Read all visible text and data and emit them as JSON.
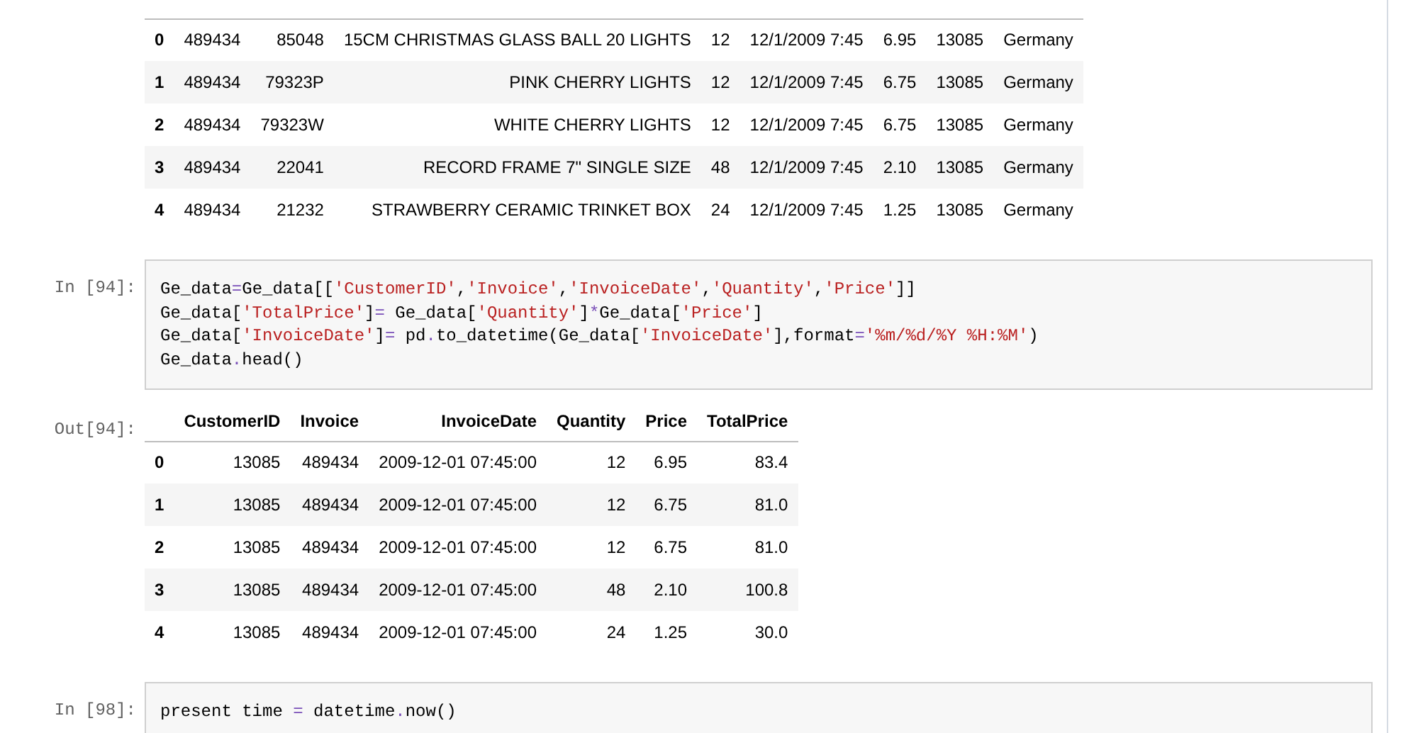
{
  "cells": [
    {
      "kind": "table",
      "columns": [
        {
          "kind": "index"
        },
        {
          "kind": "text"
        },
        {
          "kind": "number"
        },
        {
          "kind": "number"
        },
        {
          "kind": "number"
        },
        {
          "kind": "number"
        },
        {
          "kind": "number"
        },
        {
          "kind": "number"
        },
        {
          "kind": "text"
        }
      ],
      "rows": [
        [
          "0",
          "489434",
          "85048",
          "15CM CHRISTMAS GLASS BALL 20 LIGHTS",
          "12",
          "12/1/2009 7:45",
          "6.95",
          "13085",
          "Germany"
        ],
        [
          "1",
          "489434",
          "79323P",
          "PINK CHERRY LIGHTS",
          "12",
          "12/1/2009 7:45",
          "6.75",
          "13085",
          "Germany"
        ],
        [
          "2",
          "489434",
          "79323W",
          "WHITE CHERRY LIGHTS",
          "12",
          "12/1/2009 7:45",
          "6.75",
          "13085",
          "Germany"
        ],
        [
          "3",
          "489434",
          "22041",
          "RECORD FRAME 7\" SINGLE SIZE",
          "48",
          "12/1/2009 7:45",
          "2.10",
          "13085",
          "Germany"
        ],
        [
          "4",
          "489434",
          "21232",
          "STRAWBERRY CERAMIC TRINKET BOX",
          "24",
          "12/1/2009 7:45",
          "1.25",
          "13085",
          "Germany"
        ]
      ]
    },
    {
      "kind": "code",
      "prompt": "In [94]:",
      "lines": [
        [
          {
            "t": "Ge_data"
          },
          {
            "t": "=",
            "kind": "op"
          },
          {
            "t": "Ge_data[["
          },
          {
            "t": "'CustomerID'",
            "kind": "str"
          },
          {
            "t": ","
          },
          {
            "t": "'Invoice'",
            "kind": "str"
          },
          {
            "t": ","
          },
          {
            "t": "'InvoiceDate'",
            "kind": "str"
          },
          {
            "t": ","
          },
          {
            "t": "'Quantity'",
            "kind": "str"
          },
          {
            "t": ","
          },
          {
            "t": "'Price'",
            "kind": "str"
          },
          {
            "t": "]]"
          }
        ],
        [
          {
            "t": "Ge_data["
          },
          {
            "t": "'TotalPrice'",
            "kind": "str"
          },
          {
            "t": "]"
          },
          {
            "t": "=",
            "kind": "op"
          },
          {
            "t": " Ge_data["
          },
          {
            "t": "'Quantity'",
            "kind": "str"
          },
          {
            "t": "]"
          },
          {
            "t": "*",
            "kind": "op"
          },
          {
            "t": "Ge_data["
          },
          {
            "t": "'Price'",
            "kind": "str"
          },
          {
            "t": "]"
          }
        ],
        [
          {
            "t": "Ge_data["
          },
          {
            "t": "'InvoiceDate'",
            "kind": "str"
          },
          {
            "t": "]"
          },
          {
            "t": "=",
            "kind": "op"
          },
          {
            "t": " pd"
          },
          {
            "t": ".",
            "kind": "op"
          },
          {
            "t": "to_datetime(Ge_data["
          },
          {
            "t": "'InvoiceDate'",
            "kind": "str"
          },
          {
            "t": "],format"
          },
          {
            "t": "=",
            "kind": "op"
          },
          {
            "t": "'%m/%d/%Y %H:%M'",
            "kind": "str"
          },
          {
            "t": ")"
          }
        ],
        [
          {
            "t": "Ge_data"
          },
          {
            "t": ".",
            "kind": "op"
          },
          {
            "t": "head()"
          }
        ]
      ]
    },
    {
      "kind": "table",
      "prompt": "Out[94]:",
      "columns": [
        {
          "kind": "index"
        },
        {
          "kind": "number",
          "label": "CustomerID"
        },
        {
          "kind": "number",
          "label": "Invoice"
        },
        {
          "kind": "number",
          "label": "InvoiceDate"
        },
        {
          "kind": "number",
          "label": "Quantity"
        },
        {
          "kind": "number",
          "label": "Price"
        },
        {
          "kind": "number",
          "label": "TotalPrice"
        }
      ],
      "rows": [
        [
          "0",
          "13085",
          "489434",
          "2009-12-01 07:45:00",
          "12",
          "6.95",
          "83.4"
        ],
        [
          "1",
          "13085",
          "489434",
          "2009-12-01 07:45:00",
          "12",
          "6.75",
          "81.0"
        ],
        [
          "2",
          "13085",
          "489434",
          "2009-12-01 07:45:00",
          "12",
          "6.75",
          "81.0"
        ],
        [
          "3",
          "13085",
          "489434",
          "2009-12-01 07:45:00",
          "48",
          "2.10",
          "100.8"
        ],
        [
          "4",
          "13085",
          "489434",
          "2009-12-01 07:45:00",
          "24",
          "1.25",
          "30.0"
        ]
      ]
    },
    {
      "kind": "code",
      "prompt": "In [98]:",
      "lines": [
        [
          {
            "t": "present time "
          },
          {
            "t": "=",
            "kind": "op"
          },
          {
            "t": " datetime"
          },
          {
            "t": ".",
            "kind": "op"
          },
          {
            "t": "now()"
          }
        ]
      ]
    }
  ]
}
